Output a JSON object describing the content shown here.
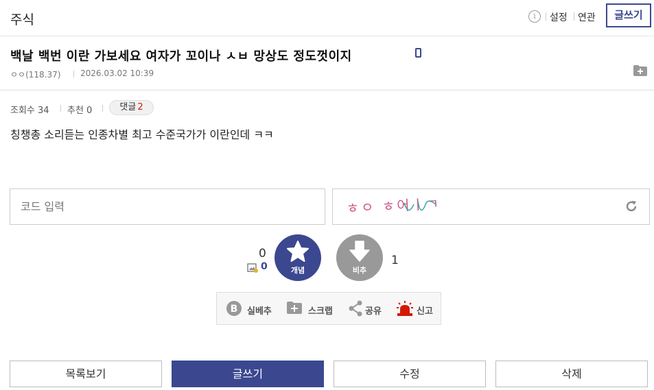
{
  "header": {
    "gallery_name": "주식",
    "info_glyph": "i",
    "settings_label": "설정",
    "related_label": "연관",
    "write_label": "글쓰기"
  },
  "post": {
    "title": "백날 백번 이란 가보세요 여자가 꼬이나 ㅅㅂ 망상도 정도껏이지",
    "author": "ㅇㅇ(118.37)",
    "datetime": "2026.03.02 10:39",
    "views_label": "조회수 34",
    "recommend_label": "추천 0",
    "comments_label": "댓글",
    "comments_count": "2",
    "body": "칭챙총 소리듣는 인종차별 최고 수준국가가 이란인데 ㅋㅋ"
  },
  "captcha": {
    "placeholder": "코드 입력",
    "image_text": "ㅎㅇ ㅎ어ㅣㄱ"
  },
  "vote": {
    "up_count": "0",
    "fixed_count": "0",
    "up_label": "개념",
    "down_label": "비추",
    "down_count": "1"
  },
  "actions": {
    "silbe_label": "실베추",
    "scrap_label": "스크랩",
    "share_label": "공유",
    "report_label": "신고"
  },
  "bottom": {
    "list_label": "목록보기",
    "write_label": "글쓰기",
    "edit_label": "수정",
    "delete_label": "삭제"
  },
  "colors": {
    "brand": "#3b4890",
    "downvote": "#999999",
    "comment_count": "#d31900",
    "report_siren": "#d31900"
  },
  "icons": [
    "info-icon",
    "mobile-icon",
    "add-folder-icon",
    "refresh-icon",
    "star-icon",
    "down-arrow-icon",
    "fixed-image-icon",
    "b-circle-icon",
    "folder-plus-icon",
    "share-icon",
    "siren-icon"
  ]
}
